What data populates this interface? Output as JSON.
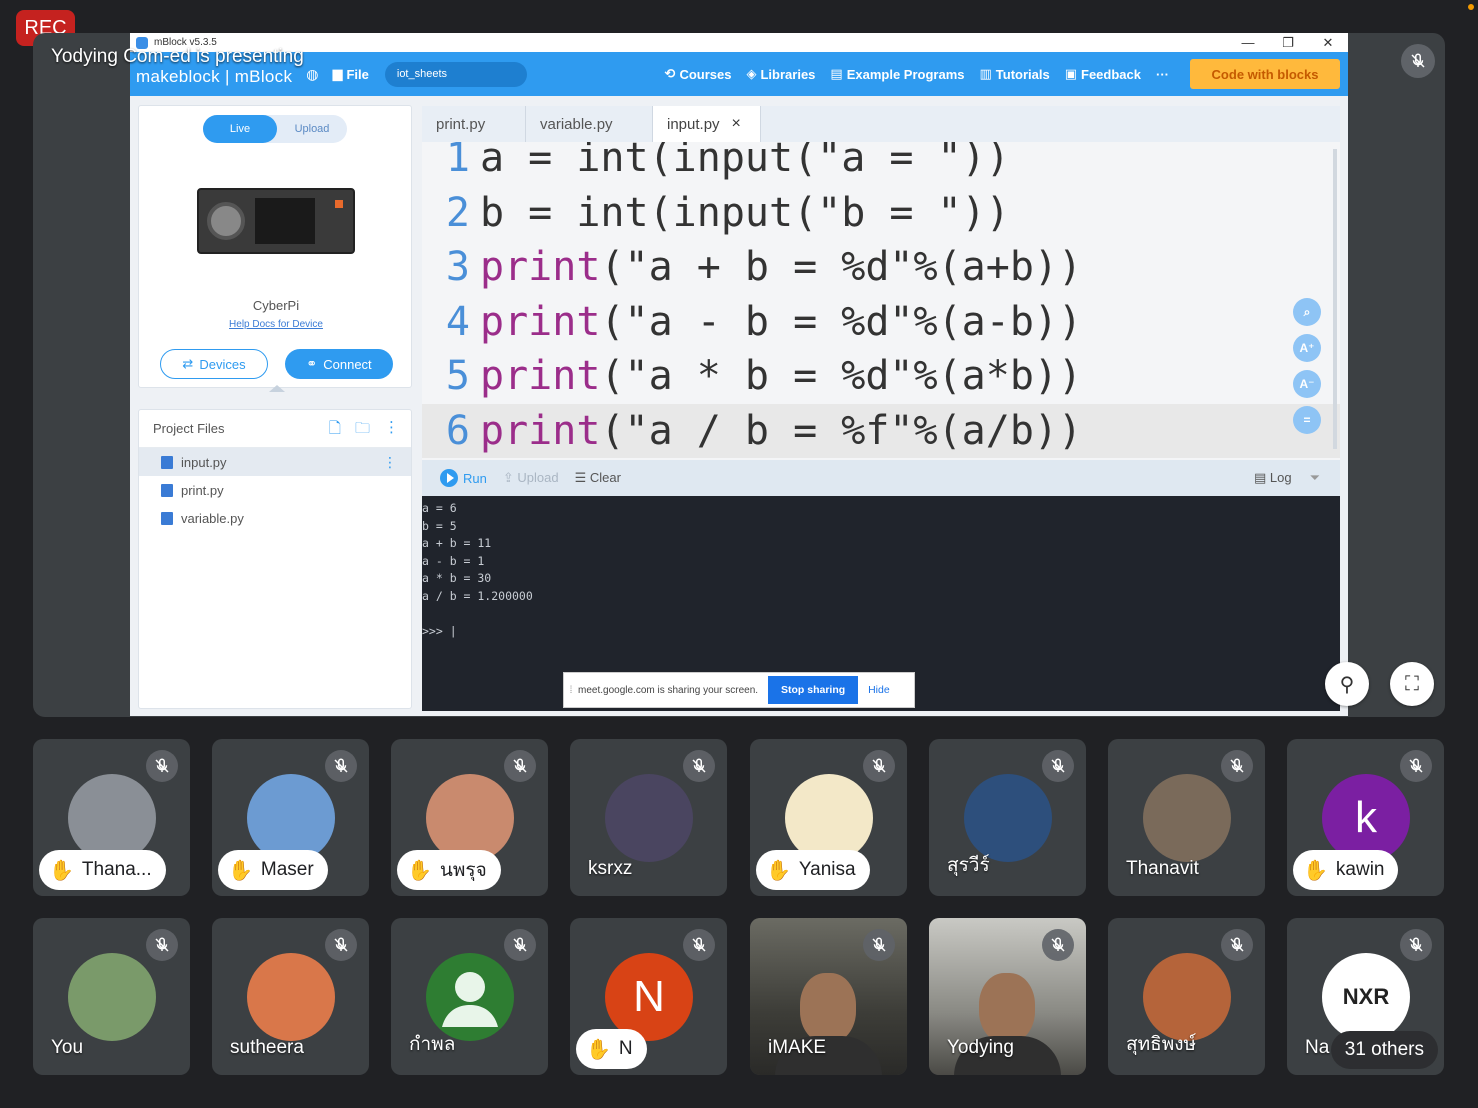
{
  "rec_label": "REC",
  "presenting_text": "Yodying Com-ed is presenting",
  "window": {
    "title": "mBlock v5.3.5",
    "controls": [
      "—",
      "❐",
      "✕"
    ],
    "brand": "makeblock | mBlock",
    "file_menu": "File",
    "project_name": "iot_sheets",
    "nav": [
      "Courses",
      "Libraries",
      "Example Programs",
      "Tutorials",
      "Feedback"
    ],
    "more": "···",
    "code_with_blocks": "Code with blocks"
  },
  "device_panel": {
    "live": "Live",
    "upload": "Upload",
    "device_name": "CyberPi",
    "help_link": "Help Docs for Device",
    "devices_btn": "Devices",
    "connect_btn": "Connect"
  },
  "project_files": {
    "title": "Project Files",
    "files": [
      "input.py",
      "print.py",
      "variable.py"
    ]
  },
  "editor": {
    "tabs": [
      "print.py",
      "variable.py",
      "input.py"
    ],
    "close_icon": "×",
    "lines": [
      {
        "n": "1",
        "code": "a = int(input(\"a = \"))"
      },
      {
        "n": "2",
        "code": "b = int(input(\"b = \"))"
      },
      {
        "n": "3",
        "kw": "print",
        "rest": "(\"a + b = %d\"%(a+b))"
      },
      {
        "n": "4",
        "kw": "print",
        "rest": "(\"a - b = %d\"%(a-b))"
      },
      {
        "n": "5",
        "kw": "print",
        "rest": "(\"a * b = %d\"%(a*b))"
      },
      {
        "n": "6",
        "kw": "print",
        "rest": "(\"a / b = %f\"%(a/b))"
      }
    ],
    "side_buttons": [
      "⌕",
      "A⁺",
      "A⁻",
      "="
    ]
  },
  "runbar": {
    "run": "Run",
    "upload": "Upload",
    "clear": "Clear",
    "log": "Log"
  },
  "console_lines": [
    "a = 6",
    "b = 5",
    "a + b = 11",
    "a - b = 1",
    "a * b = 30",
    "a / b = 1.200000",
    "",
    ">>> |"
  ],
  "share_bar": {
    "message": "meet.google.com is sharing your screen.",
    "stop": "Stop sharing",
    "hide": "Hide"
  },
  "participants": [
    {
      "name": "Thana...",
      "hand": true,
      "avatar_color": "#8a8f96",
      "initial": ""
    },
    {
      "name": "Maser",
      "hand": true,
      "avatar_color": "#6c9bd2",
      "initial": ""
    },
    {
      "name": "นพรุจ",
      "hand": true,
      "avatar_color": "#c98a6e",
      "initial": ""
    },
    {
      "name": "ksrxz",
      "hand": false,
      "avatar_color": "#4a4560",
      "initial": ""
    },
    {
      "name": "Yanisa",
      "hand": true,
      "avatar_color": "#f3e8c8",
      "initial": ""
    },
    {
      "name": "สุรวีร์",
      "hand": false,
      "avatar_color": "#2d4f7c",
      "initial": ""
    },
    {
      "name": "Thanavit",
      "hand": false,
      "avatar_color": "#7a6a5a",
      "initial": ""
    },
    {
      "name": "kawin",
      "hand": true,
      "avatar_color": "#7b1fa2",
      "initial": "k"
    },
    {
      "name": "You",
      "hand": false,
      "avatar_color": "#7a9a6a",
      "initial": ""
    },
    {
      "name": "sutheera",
      "hand": false,
      "avatar_color": "#d9774a",
      "initial": ""
    },
    {
      "name": "กำพล",
      "hand": false,
      "avatar_color": "#2e7d32",
      "initial": "person"
    },
    {
      "name": "N",
      "hand": true,
      "avatar_color": "#d84315",
      "initial": "N"
    },
    {
      "name": "iMAKE",
      "hand": false,
      "avatar_color": "",
      "initial": "",
      "video": true
    },
    {
      "name": "Yodying",
      "hand": false,
      "avatar_color": "",
      "initial": "",
      "video": true
    },
    {
      "name": "สุทธิพงษ์",
      "hand": false,
      "avatar_color": "#b5643a",
      "initial": ""
    },
    {
      "name": "Na",
      "hand": false,
      "avatar_color": "#ffffff",
      "initial": "NXR",
      "others": "31 others"
    }
  ]
}
